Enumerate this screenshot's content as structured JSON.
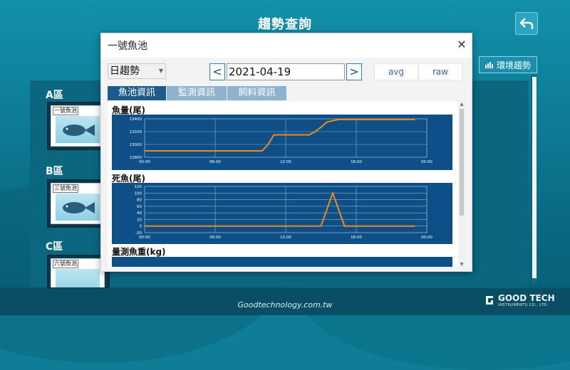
{
  "header": {
    "title": "趨勢查詢"
  },
  "env_button": {
    "label": "環境趨勢"
  },
  "zones": [
    {
      "label": "A區",
      "pond": "一號魚池"
    },
    {
      "label": "B區",
      "pond": "三號魚池"
    },
    {
      "label": "C區",
      "pond": "六號魚池"
    }
  ],
  "modal": {
    "title": "一號魚池",
    "period_select": "日趨勢",
    "date": "2021-04-19",
    "prev_label": "<",
    "next_label": ">",
    "modes": [
      "avg",
      "raw"
    ],
    "tabs": [
      "魚池資訊",
      "監測資訊",
      "飼料資訊"
    ],
    "active_tab": "魚池資訊"
  },
  "footer": {
    "url": "Goodtechnology.com.tw",
    "brand": "GOOD TECH",
    "brand_sub": "INSTRUMENTS CO., LTD."
  },
  "colors": {
    "accent": "#1e5a8b",
    "chart_bg": "#0e4f88",
    "line": "#f08a1c",
    "grid": "#8fb0cf"
  },
  "chart_data": [
    {
      "type": "line",
      "title": "魚量(尾)",
      "x_ticks": [
        "00:00",
        "06:00",
        "12:00",
        "18:00",
        "00:00"
      ],
      "y_ticks": [
        "12800",
        "13000",
        "13200",
        "13400"
      ],
      "ylim": [
        12800,
        13400
      ],
      "x": [
        0,
        3,
        6,
        9,
        9.5,
        10,
        10.5,
        11,
        11.5,
        12,
        13,
        14,
        14.5,
        15,
        15.5,
        16,
        16.5,
        17,
        18,
        21,
        23
      ],
      "values": [
        12900,
        12900,
        12900,
        12900,
        12900,
        12900,
        13000,
        13150,
        13150,
        13150,
        13150,
        13150,
        13200,
        13270,
        13350,
        13370,
        13390,
        13390,
        13390,
        13390,
        13390
      ]
    },
    {
      "type": "line",
      "title": "死魚(尾)",
      "x_ticks": [
        "00:00",
        "06:00",
        "12:00",
        "18:00",
        "00:00"
      ],
      "y_ticks": [
        "-20",
        "0",
        "20",
        "40",
        "60",
        "80",
        "100",
        "120"
      ],
      "ylim": [
        -20,
        120
      ],
      "x": [
        0,
        6,
        12,
        15,
        16,
        17,
        18,
        21,
        23
      ],
      "values": [
        0,
        0,
        0,
        0,
        100,
        0,
        0,
        0,
        0
      ]
    },
    {
      "type": "line",
      "title": "量測魚重(kg)"
    }
  ]
}
